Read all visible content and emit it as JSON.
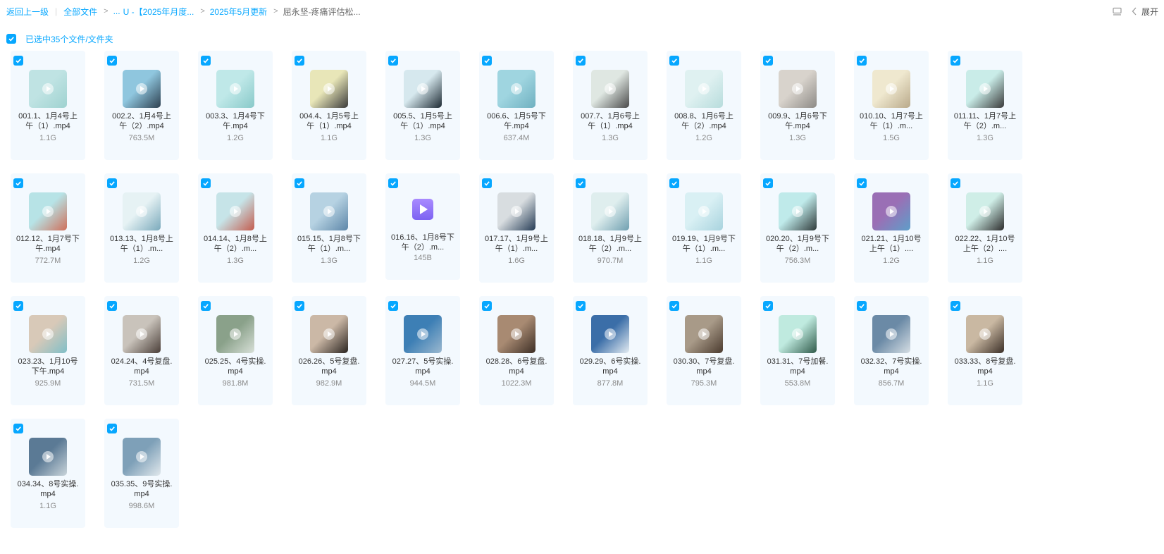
{
  "breadcrumb": {
    "back": "返回上一级",
    "all_files": "全部文件",
    "ellipsis": "...",
    "level1": "U -【2025年月度...",
    "level2": "2025年5月更新",
    "current": "屈永坚-疼痛评估松..."
  },
  "header_right": {
    "expand_label": "展开",
    "list_icon": "list-view-icon",
    "chevron_icon": "chevron-left-icon"
  },
  "selection": {
    "label": "已选中35个文件/文件夹"
  },
  "colors": {
    "accent": "#06a7ff",
    "card_bg": "#f3f9fe"
  },
  "files": [
    {
      "name": "001.1、1月4号上午（1）.mp4",
      "size": "1.1G",
      "thumb": [
        "#bfe3e3",
        "#9fd2d0"
      ]
    },
    {
      "name": "002.2、1月4号上午（2）.mp4",
      "size": "763.5M",
      "thumb": [
        "#8fc6de",
        "#2d4050"
      ]
    },
    {
      "name": "003.3、1月4号下午.mp4",
      "size": "1.2G",
      "thumb": [
        "#bfe8e8",
        "#88c9c9"
      ]
    },
    {
      "name": "004.4、1月5号上午（1）.mp4",
      "size": "1.1G",
      "thumb": [
        "#e8e6b8",
        "#3b3b3b"
      ]
    },
    {
      "name": "005.5、1月5号上午（1）.mp4",
      "size": "1.3G",
      "thumb": [
        "#d6e8ee",
        "#1d2a33"
      ]
    },
    {
      "name": "006.6、1月5号下午.mp4",
      "size": "637.4M",
      "thumb": [
        "#9fd5e0",
        "#6fb0c0"
      ]
    },
    {
      "name": "007.7、1月6号上午（1）.mp4",
      "size": "1.3G",
      "thumb": [
        "#dfe7e2",
        "#4a4a4a"
      ]
    },
    {
      "name": "008.8、1月6号上午（2）.mp4",
      "size": "1.2G",
      "thumb": [
        "#dff1f1",
        "#b7dcdc"
      ]
    },
    {
      "name": "009.9、1月6号下午.mp4",
      "size": "1.3G",
      "thumb": [
        "#d8d3cc",
        "#8d8a86"
      ]
    },
    {
      "name": "010.10、1月7号上午（1）.m...",
      "size": "1.5G",
      "thumb": [
        "#efe8cf",
        "#b9a98a"
      ]
    },
    {
      "name": "011.11、1月7号上午（2）.m...",
      "size": "1.3G",
      "thumb": [
        "#c9ece8",
        "#3a3a3a"
      ]
    },
    {
      "name": "012.12、1月7号下午.mp4",
      "size": "772.7M",
      "thumb": [
        "#b7e3e6",
        "#cf6f5a"
      ]
    },
    {
      "name": "013.13、1月8号上午（1）.m...",
      "size": "1.2G",
      "thumb": [
        "#e6f2f4",
        "#7aa9bb"
      ]
    },
    {
      "name": "014.14、1月8号上午（2）.m...",
      "size": "1.3G",
      "thumb": [
        "#c6e4e8",
        "#c45c4e"
      ]
    },
    {
      "name": "015.15、1月8号下午（1）.m...",
      "size": "1.3G",
      "thumb": [
        "#b6d2e2",
        "#5d86a8"
      ]
    },
    {
      "name": "016.16、1月8号下午（2）.m...",
      "size": "145B",
      "thumb": null
    },
    {
      "name": "017.17、1月9号上午（1）.m...",
      "size": "1.6G",
      "thumb": [
        "#d8dde0",
        "#243b55"
      ]
    },
    {
      "name": "018.18、1月9号上午（2）.m...",
      "size": "970.7M",
      "thumb": [
        "#dfeeee",
        "#6f9fb0"
      ]
    },
    {
      "name": "019.19、1月9号下午（1）.m...",
      "size": "1.1G",
      "thumb": [
        "#d9f0f4",
        "#a8d3de"
      ]
    },
    {
      "name": "020.20、1月9号下午（2）.m...",
      "size": "756.3M",
      "thumb": [
        "#bfeaea",
        "#2f3a3a"
      ]
    },
    {
      "name": "021.21、1月10号上午（1）....",
      "size": "1.2G",
      "thumb": [
        "#9a6fb5",
        "#5e9ec9"
      ]
    },
    {
      "name": "022.22、1月10号上午（2）....",
      "size": "1.1G",
      "thumb": [
        "#cfeee7",
        "#2b2b2b"
      ]
    },
    {
      "name": "023.23、1月10号下午.mp4",
      "size": "925.9M",
      "thumb": [
        "#d8c9b8",
        "#7fbfc8"
      ]
    },
    {
      "name": "024.24、4号复盘.mp4",
      "size": "731.5M",
      "thumb": [
        "#c9c3bb",
        "#4a3e38"
      ]
    },
    {
      "name": "025.25、4号实操.mp4",
      "size": "981.8M",
      "thumb": [
        "#8aa18a",
        "#d8e0d8"
      ]
    },
    {
      "name": "026.26、5号复盘.mp4",
      "size": "982.9M",
      "thumb": [
        "#cbb8a6",
        "#2a2420"
      ]
    },
    {
      "name": "027.27、5号实操.mp4",
      "size": "944.5M",
      "thumb": [
        "#3d7fb5",
        "#9bb8cf"
      ]
    },
    {
      "name": "028.28、6号复盘.mp4",
      "size": "1022.3M",
      "thumb": [
        "#a88a72",
        "#3c2e25"
      ]
    },
    {
      "name": "029.29、6号实操.mp4",
      "size": "877.8M",
      "thumb": [
        "#3b6ea8",
        "#e4ecf2"
      ]
    },
    {
      "name": "030.30、7号复盘.mp4",
      "size": "795.3M",
      "thumb": [
        "#a89a88",
        "#4a3a2e"
      ]
    },
    {
      "name": "031.31、7号加餐.mp4",
      "size": "553.8M",
      "thumb": [
        "#bfeadf",
        "#2f5a4a"
      ]
    },
    {
      "name": "032.32、7号实操.mp4",
      "size": "856.7M",
      "thumb": [
        "#6b8aa6",
        "#d6dee4"
      ]
    },
    {
      "name": "033.33、8号复盘.mp4",
      "size": "1.1G",
      "thumb": [
        "#c9b8a2",
        "#3a2e26"
      ]
    },
    {
      "name": "034.34、8号实操.mp4",
      "size": "1.1G",
      "thumb": [
        "#5b7a95",
        "#c9d4da"
      ]
    },
    {
      "name": "035.35、9号实操.mp4",
      "size": "998.6M",
      "thumb": [
        "#7ea0b8",
        "#e1e8ec"
      ]
    }
  ]
}
